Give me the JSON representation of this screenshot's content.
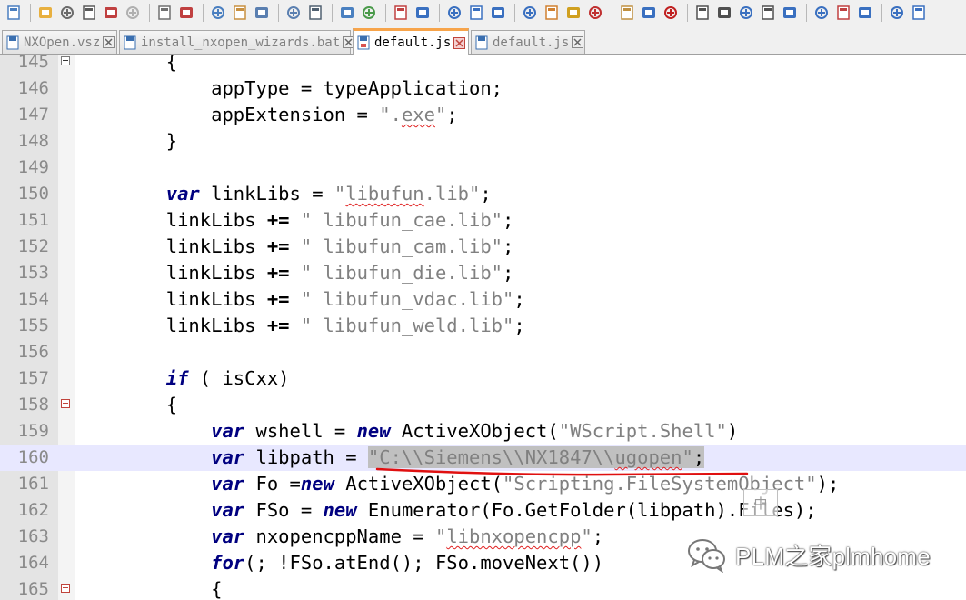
{
  "toolbar": {
    "buttons": [
      "new-file",
      "open-file",
      "save",
      "save-all",
      "close",
      "close-all",
      "print",
      "cut",
      "copy",
      "paste",
      "undo",
      "redo",
      "find",
      "replace",
      "zoom-in",
      "zoom-out",
      "sync-vertical",
      "sync-horizontal",
      "word-wrap",
      "show-all-chars",
      "indent-guide",
      "define-language",
      "document-map",
      "function-list",
      "folder-workspace",
      "monitoring",
      "record-macro",
      "stop-recording",
      "playback-macro",
      "run-macro-multiple",
      "save-macro",
      "trim",
      "view-1",
      "view-2",
      "collapse",
      "arrow-up",
      "arrow-down"
    ]
  },
  "tabs": [
    {
      "label": "NXOpen.vsz",
      "active": false,
      "state": "saved"
    },
    {
      "label": "install_nxopen_wizards.bat",
      "active": false,
      "state": "saved"
    },
    {
      "label": "default.js",
      "active": true,
      "state": "modified"
    },
    {
      "label": "default.js",
      "active": false,
      "state": "saved"
    }
  ],
  "editor": {
    "current_line": 160,
    "lines": [
      {
        "n": "145",
        "fold": "open",
        "tokens": [
          [
            "",
            "        {"
          ]
        ]
      },
      {
        "n": "146",
        "fold": "",
        "tokens": [
          [
            "",
            "            appType = typeApplication;"
          ]
        ]
      },
      {
        "n": "147",
        "fold": "",
        "tokens": [
          [
            "",
            "            appExtension = "
          ],
          [
            "str",
            "\"."
          ],
          [
            "str squig",
            "exe"
          ],
          [
            "str",
            "\""
          ],
          [
            "",
            ";"
          ]
        ]
      },
      {
        "n": "148",
        "fold": "",
        "tokens": [
          [
            "",
            "        }"
          ]
        ]
      },
      {
        "n": "149",
        "fold": "",
        "tokens": [
          [
            "",
            ""
          ]
        ]
      },
      {
        "n": "150",
        "fold": "",
        "tokens": [
          [
            "",
            "        "
          ],
          [
            "kw",
            "var"
          ],
          [
            "",
            " linkLibs = "
          ],
          [
            "str",
            "\""
          ],
          [
            "str squig",
            "libufun"
          ],
          [
            "str",
            ".lib\""
          ],
          [
            "",
            ";"
          ]
        ]
      },
      {
        "n": "151",
        "fold": "",
        "tokens": [
          [
            "",
            "        linkLibs "
          ],
          [
            "op",
            "+="
          ],
          [
            "",
            " "
          ],
          [
            "str",
            "\" libufun_cae.lib\""
          ],
          [
            "",
            ";"
          ]
        ]
      },
      {
        "n": "152",
        "fold": "",
        "tokens": [
          [
            "",
            "        linkLibs "
          ],
          [
            "op",
            "+="
          ],
          [
            "",
            " "
          ],
          [
            "str",
            "\" libufun_cam.lib\""
          ],
          [
            "",
            ";"
          ]
        ]
      },
      {
        "n": "153",
        "fold": "",
        "tokens": [
          [
            "",
            "        linkLibs "
          ],
          [
            "op",
            "+="
          ],
          [
            "",
            " "
          ],
          [
            "str",
            "\" libufun_die.lib\""
          ],
          [
            "",
            ";"
          ]
        ]
      },
      {
        "n": "154",
        "fold": "",
        "tokens": [
          [
            "",
            "        linkLibs "
          ],
          [
            "op",
            "+="
          ],
          [
            "",
            " "
          ],
          [
            "str",
            "\" libufun_vdac.lib\""
          ],
          [
            "",
            ";"
          ]
        ]
      },
      {
        "n": "155",
        "fold": "",
        "tokens": [
          [
            "",
            "        linkLibs "
          ],
          [
            "op",
            "+="
          ],
          [
            "",
            " "
          ],
          [
            "str",
            "\" libufun_weld.lib\""
          ],
          [
            "",
            ";"
          ]
        ]
      },
      {
        "n": "156",
        "fold": "",
        "tokens": [
          [
            "",
            ""
          ]
        ]
      },
      {
        "n": "157",
        "fold": "",
        "tokens": [
          [
            "",
            "        "
          ],
          [
            "kw",
            "if"
          ],
          [
            "",
            " ( isCxx)"
          ]
        ]
      },
      {
        "n": "158",
        "fold": "open-red",
        "tokens": [
          [
            "",
            "        {"
          ]
        ]
      },
      {
        "n": "159",
        "fold": "",
        "tokens": [
          [
            "",
            "            "
          ],
          [
            "kw",
            "var"
          ],
          [
            "",
            " wshell = "
          ],
          [
            "kw",
            "new"
          ],
          [
            "",
            " ActiveXObject("
          ],
          [
            "str",
            "\"WScript.Shell\""
          ],
          [
            "",
            ")"
          ]
        ]
      },
      {
        "n": "160",
        "fold": "",
        "tokens": [
          [
            "",
            "            "
          ],
          [
            "kw",
            "var"
          ],
          [
            "",
            " libpath = "
          ],
          [
            "str sel",
            "\"C:\\\\Siemens\\\\NX1847\\\\"
          ],
          [
            "str sel squig",
            "ugopen"
          ],
          [
            "str sel",
            "\""
          ],
          [
            "sel",
            ";"
          ]
        ]
      },
      {
        "n": "161",
        "fold": "",
        "tokens": [
          [
            "",
            "            "
          ],
          [
            "kw",
            "var"
          ],
          [
            "",
            " Fo ="
          ],
          [
            "kw",
            "new"
          ],
          [
            "",
            " ActiveXObject("
          ],
          [
            "str",
            "\"Scripting.FileSystemObject\""
          ],
          [
            "",
            ");"
          ]
        ]
      },
      {
        "n": "162",
        "fold": "",
        "tokens": [
          [
            "",
            "            "
          ],
          [
            "kw",
            "var"
          ],
          [
            "",
            " FSo = "
          ],
          [
            "kw",
            "new"
          ],
          [
            "",
            " Enumerator(Fo.GetFolder(libpath).Files);"
          ]
        ]
      },
      {
        "n": "163",
        "fold": "",
        "tokens": [
          [
            "",
            "            "
          ],
          [
            "kw",
            "var"
          ],
          [
            "",
            " nxopencppName = "
          ],
          [
            "str",
            "\""
          ],
          [
            "str squig",
            "libnxopencpp"
          ],
          [
            "str",
            "\""
          ],
          [
            "",
            ";"
          ]
        ]
      },
      {
        "n": "164",
        "fold": "",
        "tokens": [
          [
            "",
            "            "
          ],
          [
            "kw",
            "for"
          ],
          [
            "",
            "(; !FSo.atEnd(); FSo.moveNext())"
          ]
        ]
      },
      {
        "n": "165",
        "fold": "open-red",
        "tokens": [
          [
            "",
            "            {"
          ]
        ]
      }
    ]
  },
  "overlay": {
    "ime_label": "中",
    "watermark_text": "PLM之家plmhome"
  }
}
